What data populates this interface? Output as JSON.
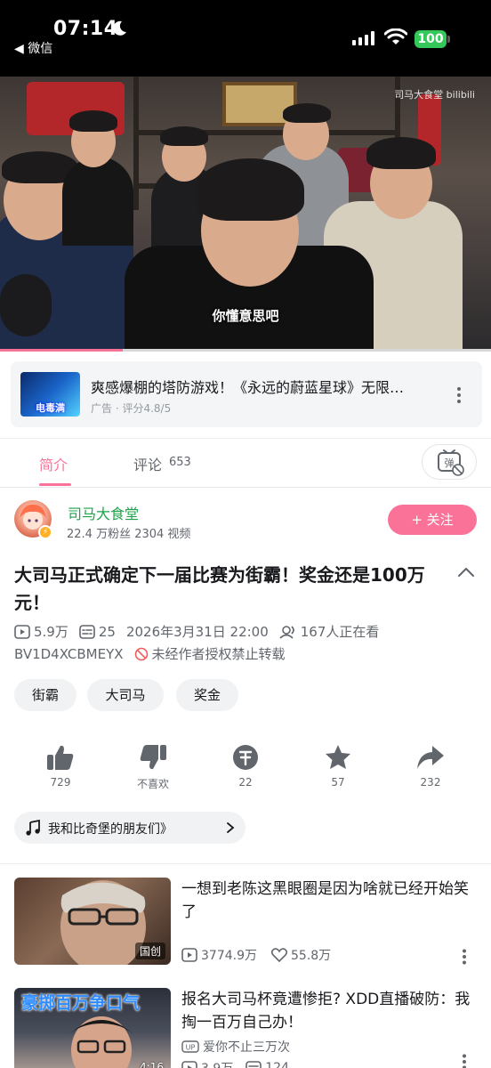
{
  "status_bar": {
    "time": "07:14",
    "back_app": "◀ 微信",
    "battery": "100"
  },
  "video": {
    "caption": "你懂意思吧",
    "watermark": "司马大食堂 bilibili",
    "progress": 0.25
  },
  "ad": {
    "thumb_text": "电毒满",
    "title": "爽感爆棚的塔防游戏！《永远的蔚蓝星球》无限…",
    "meta": "广告 · 评分4.8/5"
  },
  "tabs": {
    "intro_label": "简介",
    "comments_label": "评论",
    "comments_count": "653"
  },
  "uploader": {
    "name": "司马大食堂",
    "stats": "22.4 万粉丝  2304 视频",
    "follow_label": "+ 关注"
  },
  "video_info": {
    "title": "大司马正式确定下一届比赛为街霸！奖金还是100万元！",
    "views": "5.9万",
    "danmaku": "25",
    "date": "2026年3月31日 22:00",
    "watching": "167人正在看",
    "bvid": "BV1D4XCBMEYX",
    "copyright_notice": "未经作者授权禁止转载"
  },
  "tags": [
    "街霸",
    "大司马",
    "奖金"
  ],
  "actions": {
    "like": {
      "icon": "thumbs-up-icon",
      "count": "729"
    },
    "dislike": {
      "icon": "thumbs-down-icon",
      "label": "不喜欢"
    },
    "coin": {
      "icon": "coin-icon",
      "count": "22"
    },
    "favorite": {
      "icon": "star-icon",
      "count": "57"
    },
    "share": {
      "icon": "share-icon",
      "count": "232"
    }
  },
  "music": {
    "text": "我和比奇堡的朋友们》"
  },
  "related": [
    {
      "title": "一想到老陈这黑眼圈是因为啥就已经开始笑了",
      "badge": "国创",
      "views": "3774.9万",
      "likes": "55.8万"
    },
    {
      "title": "报名大司马杯竟遭惨拒? XDD直播破防：我掏一百万自己办！",
      "overlay_text": "豪掷百万争口气",
      "duration": "4:16",
      "up_name": "爱你不止三万次",
      "views": "3.9万",
      "comments": "124"
    }
  ],
  "colors": {
    "brand_pink": "#fb7299",
    "uploader_green": "#1ca34a",
    "battery_green": "#34c759"
  }
}
